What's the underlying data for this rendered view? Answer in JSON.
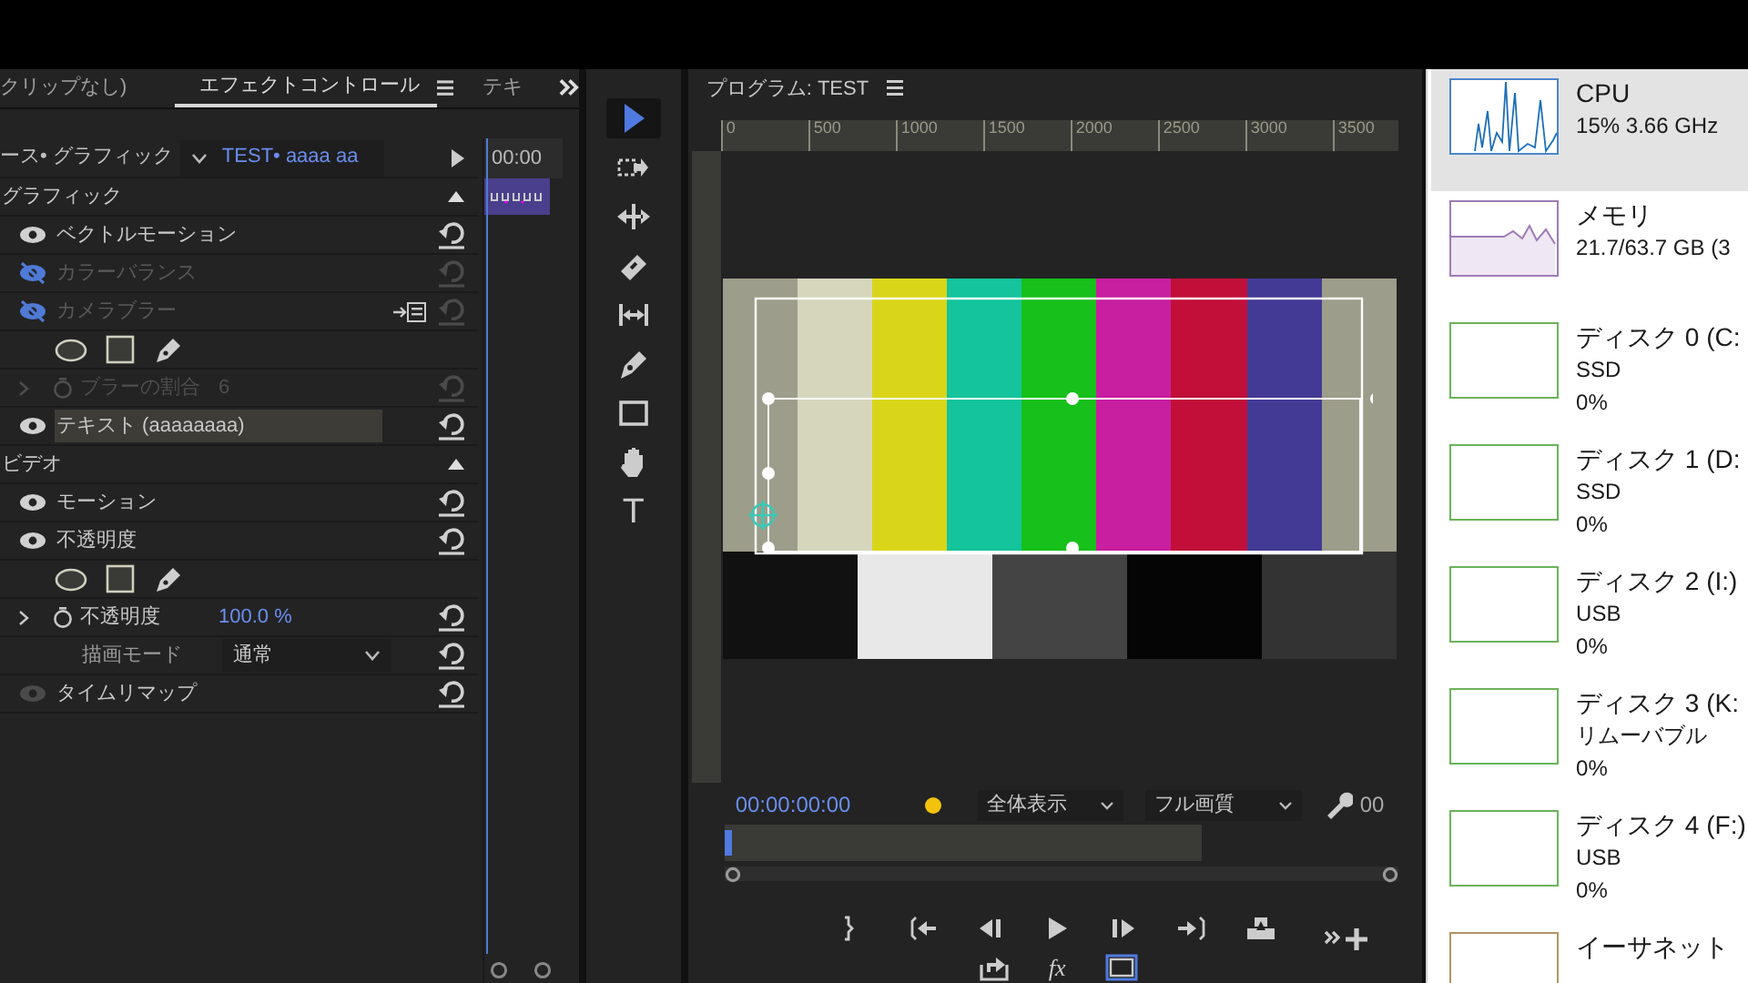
{
  "effect_controls": {
    "tabs": [
      {
        "label": "クリップなし)",
        "selected": false
      },
      {
        "label": "エフェクトコントロール",
        "selected": true
      },
      {
        "label": "テキ",
        "selected": false
      }
    ],
    "source_label": "ース• グラフィック",
    "source_value": "TEST• aaaa aa",
    "timecode": "00:00",
    "sections": [
      {
        "title": "グラフィック",
        "rows": [
          {
            "kind": "effect",
            "label": "ベクトルモーション",
            "hidden": false,
            "eye_disabled": false,
            "disabled": false,
            "selected": false,
            "mask_link": false
          },
          {
            "kind": "effect",
            "label": "カラーバランス",
            "hidden": true,
            "eye_disabled": false,
            "disabled": true,
            "selected": false,
            "mask_link": false
          },
          {
            "kind": "effect",
            "label": "カメラブラー",
            "hidden": true,
            "eye_disabled": false,
            "disabled": true,
            "selected": false,
            "mask_link": true
          },
          {
            "kind": "masks"
          },
          {
            "kind": "param",
            "label": "ブラーの割合",
            "value": "6",
            "disabled": true
          },
          {
            "kind": "effect",
            "label": "テキスト (aaaaaaaa)",
            "hidden": false,
            "eye_disabled": false,
            "disabled": false,
            "selected": true,
            "mask_link": false
          }
        ]
      },
      {
        "title": "ビデオ",
        "rows": [
          {
            "kind": "effect",
            "label": "モーション",
            "hidden": false,
            "eye_disabled": false,
            "disabled": false,
            "selected": false,
            "mask_link": false
          },
          {
            "kind": "effect",
            "label": "不透明度",
            "hidden": false,
            "eye_disabled": false,
            "disabled": false,
            "selected": false,
            "mask_link": false
          },
          {
            "kind": "masks"
          },
          {
            "kind": "param",
            "label": "不透明度",
            "value": "100.0 %",
            "disabled": false
          },
          {
            "kind": "dropdown",
            "label": "描画モード",
            "value": "通常"
          },
          {
            "kind": "effect",
            "label": "タイムリマップ",
            "hidden": false,
            "eye_disabled": true,
            "disabled": false,
            "selected": false,
            "mask_link": false
          }
        ]
      }
    ]
  },
  "tools": [
    {
      "kind": "select",
      "selected": true
    },
    {
      "kind": "track-select",
      "selected": false
    },
    {
      "kind": "ripple",
      "selected": false
    },
    {
      "kind": "razor",
      "selected": false
    },
    {
      "kind": "slip",
      "selected": false
    },
    {
      "kind": "pen",
      "selected": false
    },
    {
      "kind": "rectangle",
      "selected": false
    },
    {
      "kind": "hand",
      "selected": false
    },
    {
      "kind": "type",
      "selected": false,
      "glyph": "T"
    }
  ],
  "program": {
    "title": "プログラム: TEST",
    "ruler": [
      "0",
      "500",
      "1000",
      "1500",
      "2000",
      "2500",
      "3000",
      "3500"
    ],
    "timecode": "00:00:00:00",
    "zoom": "全体表示",
    "quality": "フル画質",
    "duration": "00",
    "fx_label": "fx",
    "playhead": {
      "level": 0
    }
  },
  "performance": [
    {
      "kind": "cpu",
      "name": "CPU",
      "lines": [
        "15% 3.66 GHz"
      ],
      "selected": true
    },
    {
      "kind": "memory",
      "name": "メモリ",
      "lines": [
        "21.7/63.7 GB (3"
      ],
      "selected": false
    },
    {
      "kind": "disk",
      "name": "ディスク 0 (C:",
      "lines": [
        "SSD",
        "0%"
      ],
      "selected": false
    },
    {
      "kind": "disk",
      "name": "ディスク 1 (D:",
      "lines": [
        "SSD",
        "0%"
      ],
      "selected": false
    },
    {
      "kind": "disk",
      "name": "ディスク 2 (I:)",
      "lines": [
        "USB",
        "0%"
      ],
      "selected": false
    },
    {
      "kind": "disk",
      "name": "ディスク 3 (K:",
      "lines": [
        "リムーバブル",
        "0%"
      ],
      "selected": false
    },
    {
      "kind": "disk",
      "name": "ディスク 4 (F:)",
      "lines": [
        "USB",
        "0%"
      ],
      "selected": false
    },
    {
      "kind": "network",
      "name": "イーサネット",
      "selected": false
    }
  ]
}
